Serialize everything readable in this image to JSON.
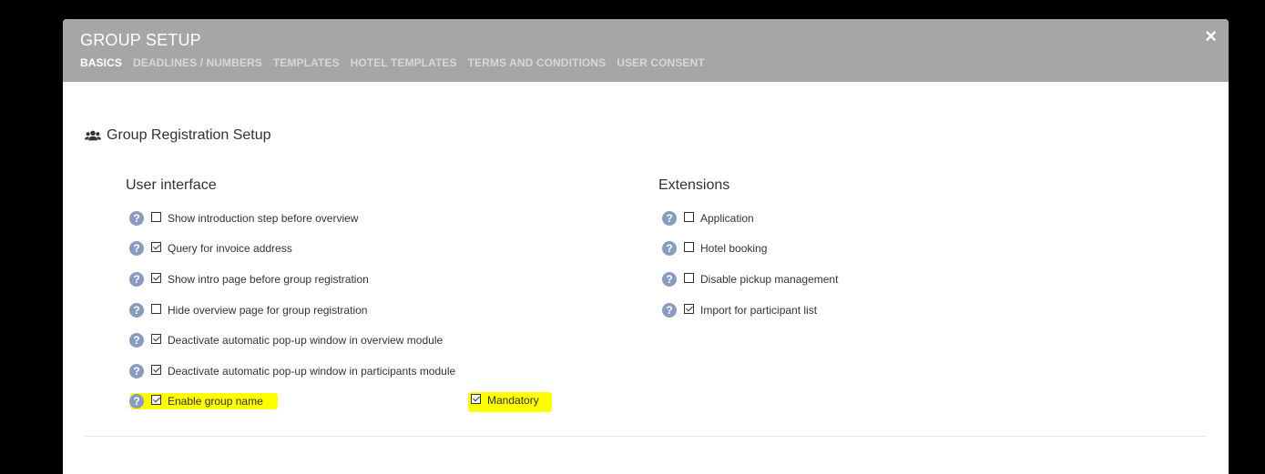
{
  "header": {
    "title": "GROUP SETUP",
    "close_icon": "close-icon",
    "tabs": [
      {
        "label": "BASICS",
        "active": true
      },
      {
        "label": "DEADLINES / NUMBERS",
        "active": false
      },
      {
        "label": "TEMPLATES",
        "active": false
      },
      {
        "label": "HOTEL TEMPLATES",
        "active": false
      },
      {
        "label": "TERMS AND CONDITIONS",
        "active": false
      },
      {
        "label": "USER CONSENT",
        "active": false
      }
    ],
    "close_label": "×"
  },
  "section": {
    "title": "Group Registration Setup",
    "icon": "group-icon"
  },
  "user_interface": {
    "title": "User interface",
    "options": [
      {
        "label": "Show introduction step before overview",
        "checked": false
      },
      {
        "label": "Query for invoice address",
        "checked": true
      },
      {
        "label": "Show intro page before group registration",
        "checked": true
      },
      {
        "label": "Hide overview page for group registration",
        "checked": false
      },
      {
        "label": "Deactivate automatic pop-up window in overview module",
        "checked": true
      },
      {
        "label": "Deactivate automatic pop-up window in participants module",
        "checked": true
      },
      {
        "label": "Enable group name",
        "checked": true
      }
    ],
    "mandatory": {
      "label": "Mandatory",
      "checked": true
    }
  },
  "extensions": {
    "title": "Extensions",
    "options": [
      {
        "label": "Application",
        "checked": false
      },
      {
        "label": "Hotel booking",
        "checked": false
      },
      {
        "label": "Disable pickup management",
        "checked": false
      },
      {
        "label": "Import for participant list",
        "checked": true
      }
    ]
  },
  "colors": {
    "header_bg": "#a6a6a6",
    "help_icon": "#8a9bc2",
    "highlight": "#ffff00"
  },
  "help_glyph": "?"
}
